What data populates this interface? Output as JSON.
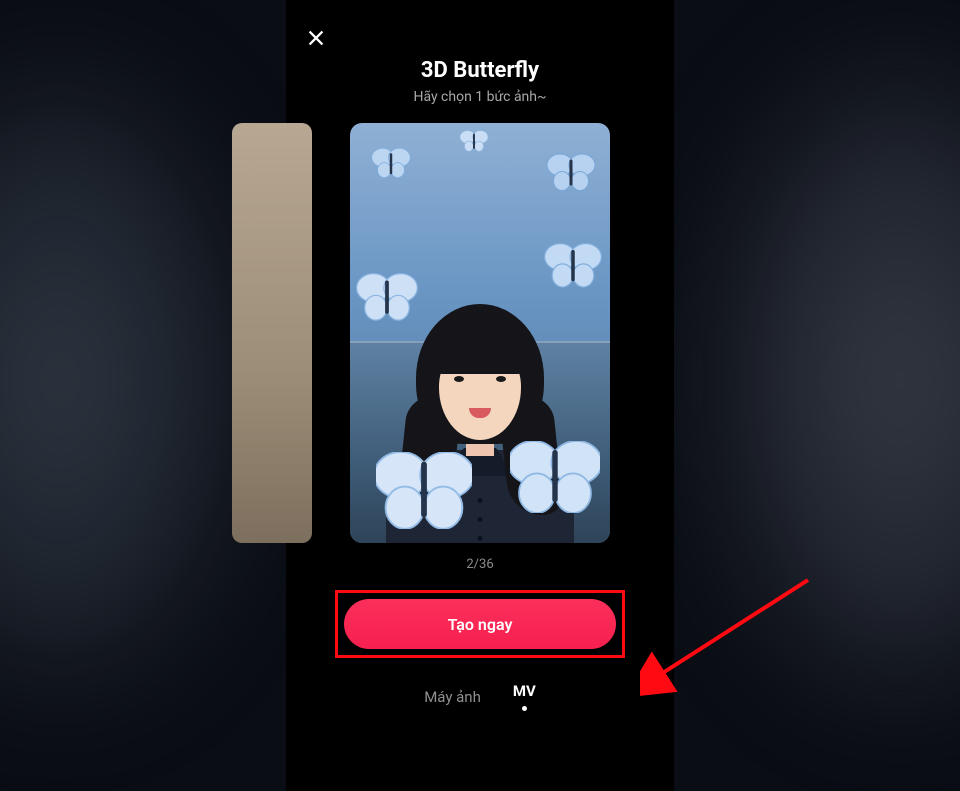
{
  "header": {
    "title": "3D Butterfly",
    "subtitle": "Hãy chọn 1 bức ảnh~"
  },
  "preview": {
    "counter": "2/36"
  },
  "cta": {
    "label": "Tạo ngay"
  },
  "tabs": {
    "camera": "Máy ảnh",
    "mv": "MV"
  },
  "colors": {
    "accent": "#f71f4f",
    "highlight": "#ff0a12"
  }
}
